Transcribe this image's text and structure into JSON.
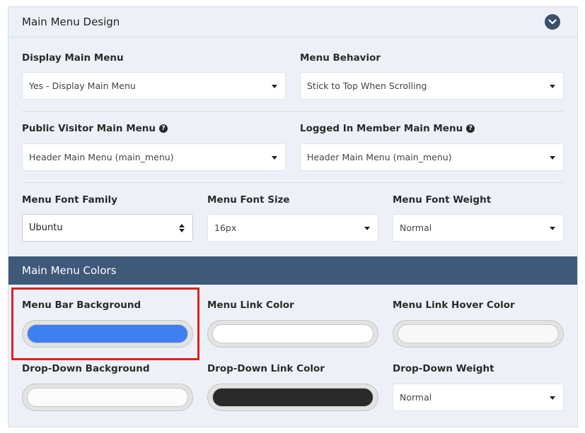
{
  "header": {
    "title": "Main Menu Design",
    "collapse_icon": "chevron-down-icon"
  },
  "fields": {
    "display_main_menu": {
      "label": "Display Main Menu",
      "value": "Yes - Display Main Menu"
    },
    "menu_behavior": {
      "label": "Menu Behavior",
      "value": "Stick to Top When Scrolling"
    },
    "public_visitor_menu": {
      "label": "Public Visitor Main Menu",
      "value": "Header Main Menu (main_menu)"
    },
    "logged_in_menu": {
      "label": "Logged In Member Main Menu",
      "value": "Header Main Menu (main_menu)"
    },
    "font_family": {
      "label": "Menu Font Family",
      "value": "Ubuntu"
    },
    "font_size": {
      "label": "Menu Font Size",
      "value": "16px"
    },
    "font_weight": {
      "label": "Menu Font Weight",
      "value": "Normal"
    }
  },
  "colors_section": {
    "title": "Main Menu Colors",
    "menu_bar_background": {
      "label": "Menu Bar Background",
      "color": "#3f7ff0"
    },
    "menu_link_color": {
      "label": "Menu Link Color",
      "color": "#ffffff"
    },
    "menu_link_hover_color": {
      "label": "Menu Link Hover Color",
      "color": "#f8f8f8"
    },
    "dropdown_background": {
      "label": "Drop-Down Background",
      "color": "#fbfbfb"
    },
    "dropdown_link_color": {
      "label": "Drop-Down Link Color",
      "color": "#2a2a2a"
    },
    "dropdown_weight": {
      "label": "Drop-Down Weight",
      "value": "Normal"
    }
  },
  "theme": {
    "panel_bg": "#edf1f7",
    "section_bar_bg": "#3f5979",
    "highlight_border": "#e02020"
  }
}
